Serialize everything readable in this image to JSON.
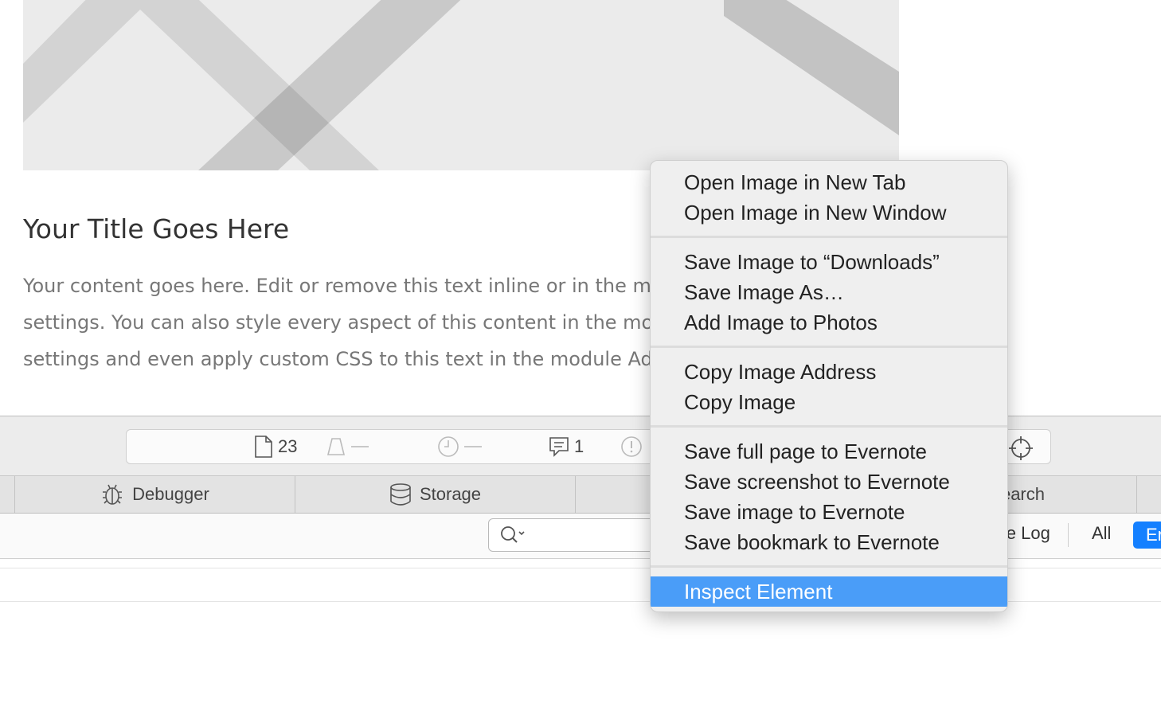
{
  "content": {
    "title": "Your Title Goes Here",
    "body_lines": [
      "Your content goes here. Edit or remove this text inline or in the module Content",
      "settings. You can also style every aspect of this content in the module Design",
      "settings and even apply custom CSS to this text in the module Advanced settings."
    ]
  },
  "devtools": {
    "dashboard": {
      "resources_count": "23",
      "messages_count": "1"
    },
    "tabs": [
      {
        "label": "Debugger",
        "icon": "bug-icon"
      },
      {
        "label": "Storage",
        "icon": "database-icon"
      },
      {
        "label": "Search",
        "icon": "search-icon"
      }
    ],
    "filter": {
      "search_placeholder": "",
      "preserve_log": "Preserve Log",
      "all": "All",
      "errors": "Errors"
    }
  },
  "context_menu": {
    "groups": [
      [
        "Open Image in New Tab",
        "Open Image in New Window"
      ],
      [
        "Save Image to “Downloads”",
        "Save Image As…",
        "Add Image to Photos"
      ],
      [
        "Copy Image Address",
        "Copy Image"
      ],
      [
        "Save full page to Evernote",
        "Save screenshot to Evernote",
        "Save image to Evernote",
        "Save bookmark to Evernote"
      ],
      [
        "Inspect Element"
      ]
    ],
    "highlighted": "Inspect Element"
  },
  "colors": {
    "highlight": "#4a9df8",
    "active_filter": "#1480ff"
  }
}
